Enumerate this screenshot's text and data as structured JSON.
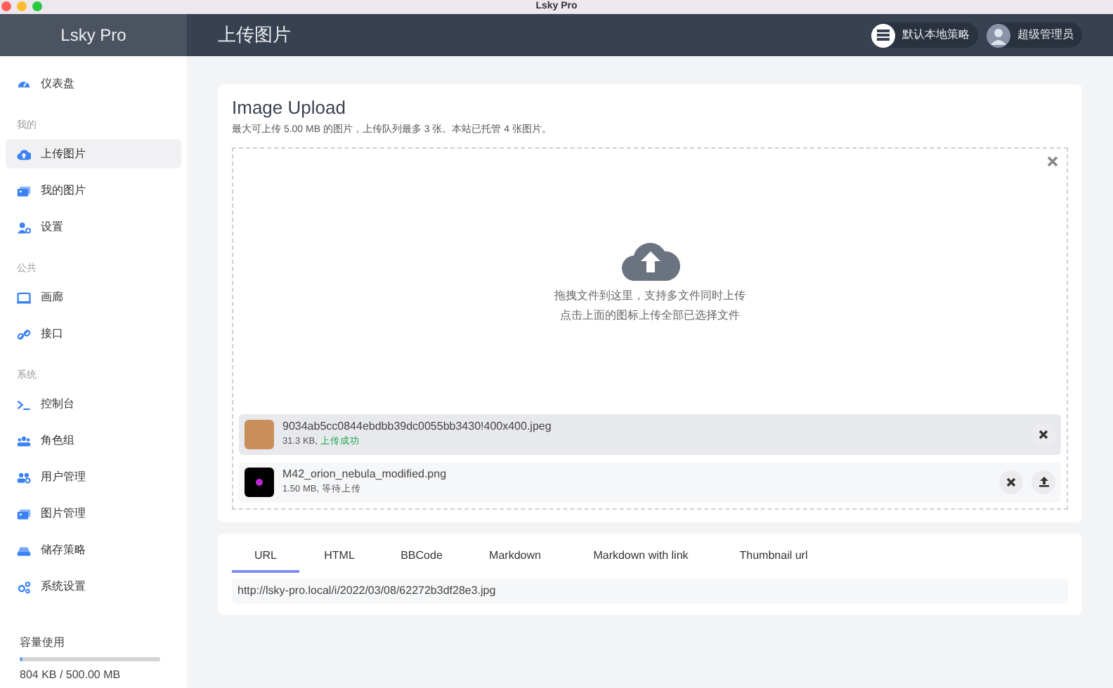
{
  "window": {
    "title": "Lsky Pro"
  },
  "header": {
    "brand": "Lsky Pro",
    "page_title": "上传图片",
    "strategy": "默认本地策略",
    "user": "超级管理员"
  },
  "sidebar": {
    "groups": [
      {
        "items": [
          {
            "label": "仪表盘",
            "kind": "gauge",
            "selected": false
          }
        ]
      },
      {
        "title": "我的",
        "items": [
          {
            "label": "上传图片",
            "kind": "cloud",
            "selected": true
          },
          {
            "label": "我的图片",
            "kind": "images",
            "selected": false
          },
          {
            "label": "设置",
            "kind": "profile",
            "selected": false
          }
        ]
      },
      {
        "title": "公共",
        "items": [
          {
            "label": "画廊",
            "kind": "monitor",
            "selected": false
          },
          {
            "label": "接口",
            "kind": "link",
            "selected": false
          }
        ]
      },
      {
        "title": "系统",
        "items": [
          {
            "label": "控制台",
            "kind": "terminal",
            "selected": false
          },
          {
            "label": "角色组",
            "kind": "users",
            "selected": false
          },
          {
            "label": "用户管理",
            "kind": "accounts",
            "selected": false
          },
          {
            "label": "图片管理",
            "kind": "images",
            "selected": false
          },
          {
            "label": "储存策略",
            "kind": "drive",
            "selected": false
          },
          {
            "label": "系统设置",
            "kind": "gears",
            "selected": false
          }
        ]
      }
    ],
    "storage": {
      "title": "容量使用",
      "level": 0.02,
      "reading": "804 KB / 500.00 MB"
    }
  },
  "upload": {
    "title": "Image Upload",
    "subtitle": "最大可上传 5.00 MB 的图片，上传队列最多 3 张。本站已托管 4 张图片。",
    "hint_lines": [
      "拖拽文件到这里，支持多文件同时上传",
      "点击上面的图标上传全部已选择文件"
    ],
    "files": [
      {
        "name": "9034ab5cc0844ebdbb39dc0055bb3430!400x400.jpeg",
        "size": "31.3 KB,",
        "status": "上传成功",
        "uploaded": true
      },
      {
        "name": "M42_orion_nebula_modified.png",
        "size": "1.50 MB,",
        "status": "等待上传",
        "uploaded": false
      }
    ]
  },
  "links": {
    "tabs": [
      {
        "label": "URL",
        "selected": true
      },
      {
        "label": "HTML",
        "selected": false
      },
      {
        "label": "BBCode",
        "selected": false
      },
      {
        "label": "Markdown",
        "selected": false
      },
      {
        "label": "Markdown with link",
        "selected": false
      },
      {
        "label": "Thumbnail url",
        "selected": false
      }
    ],
    "value": "http://lsky-pro.local/i/2022/03/08/62272b3df28e3.jpg"
  }
}
